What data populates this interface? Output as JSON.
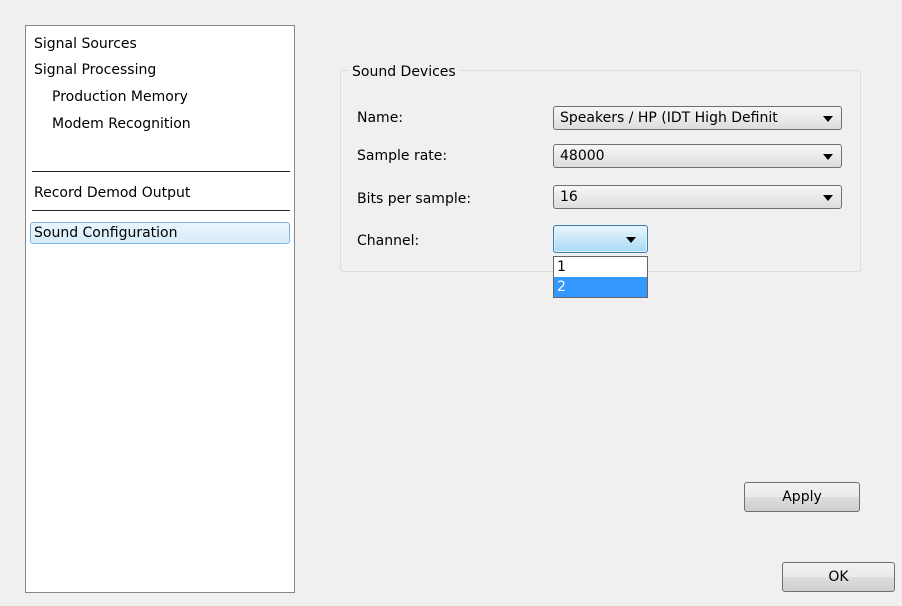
{
  "sidebar": {
    "items": [
      {
        "label": "Signal Sources"
      },
      {
        "label": "Signal Processing"
      },
      {
        "label": "Production Memory"
      },
      {
        "label": "Modem Recognition"
      },
      {
        "label": "Record Demod Output"
      },
      {
        "label": "Sound Configuration",
        "selected": true
      }
    ]
  },
  "sound_devices": {
    "title": "Sound Devices",
    "name": {
      "label": "Name:",
      "value": "Speakers / HP (IDT High Definit"
    },
    "sample_rate": {
      "label": "Sample rate:",
      "value": "48000"
    },
    "bits": {
      "label": "Bits per sample:",
      "value": "16"
    },
    "channel": {
      "label": "Channel:",
      "value": "",
      "options": [
        "1",
        "2"
      ],
      "highlighted": "2"
    }
  },
  "buttons": {
    "apply": "Apply",
    "ok": "OK"
  },
  "colors": {
    "selection": "#3399ff",
    "sidebar_selected_bg": "#d7ecfb"
  }
}
